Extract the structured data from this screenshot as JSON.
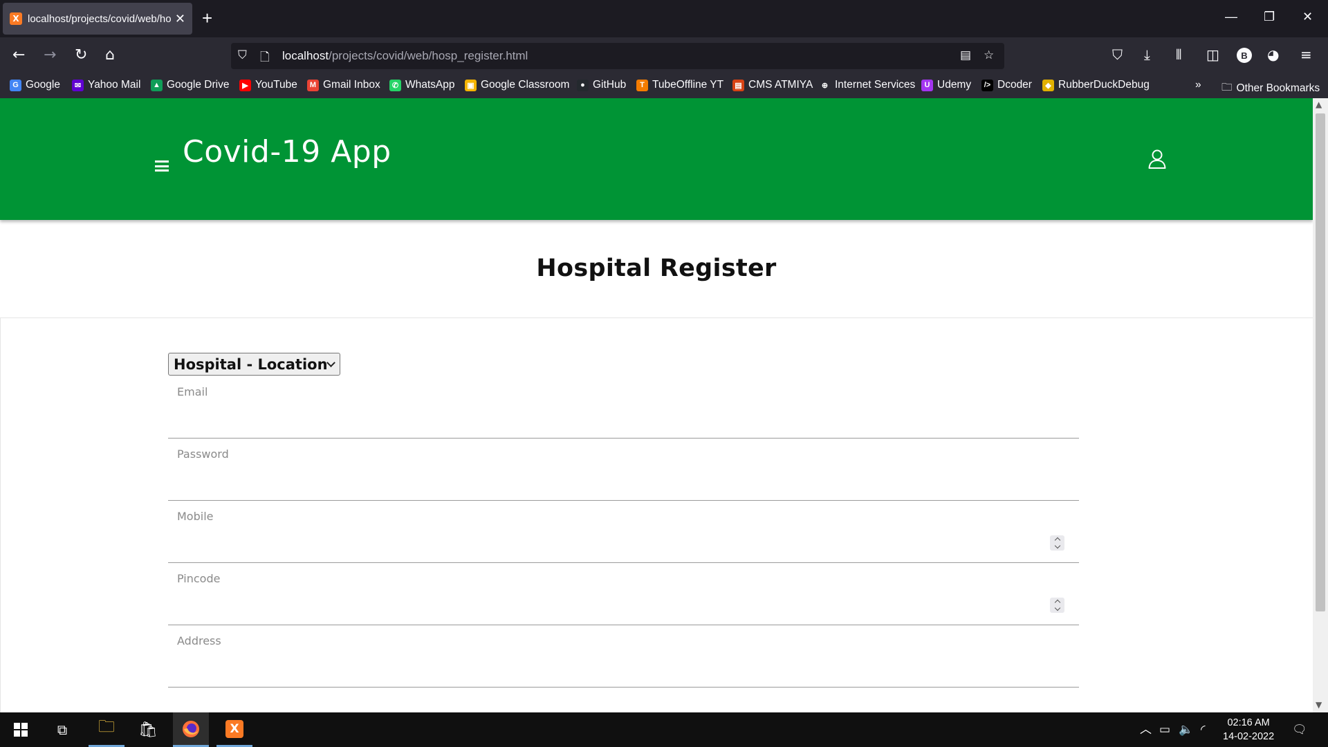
{
  "browser": {
    "tab_title": "localhost/projects/covid/web/hosp_register.html",
    "tab_favicon": "X",
    "new_tab_symbol": "+",
    "url_host": "localhost",
    "url_path": "/projects/covid/web/hosp_register.html",
    "bookmarks": [
      {
        "label": "Google",
        "icon": "google-icon",
        "color": "#4285f4",
        "glyph": "G"
      },
      {
        "label": "Yahoo Mail",
        "icon": "yahoo-mail-icon",
        "color": "#6001d2",
        "glyph": "✉"
      },
      {
        "label": "Google Drive",
        "icon": "google-drive-icon",
        "color": "#0f9d58",
        "glyph": "▲"
      },
      {
        "label": "YouTube",
        "icon": "youtube-icon",
        "color": "#ff0000",
        "glyph": "▶"
      },
      {
        "label": "Gmail Inbox",
        "icon": "gmail-icon",
        "color": "#ea4335",
        "glyph": "M"
      },
      {
        "label": "WhatsApp",
        "icon": "whatsapp-icon",
        "color": "#25d366",
        "glyph": "✆"
      },
      {
        "label": "Google Classroom",
        "icon": "google-classroom-icon",
        "color": "#f4b400",
        "glyph": "▣"
      },
      {
        "label": "GitHub",
        "icon": "github-icon",
        "color": "#24292e",
        "glyph": "●"
      },
      {
        "label": "TubeOffline YT",
        "icon": "tubeoffline-icon",
        "color": "#f57c00",
        "glyph": "T"
      },
      {
        "label": "CMS ATMIYA",
        "icon": "cms-atmiya-icon",
        "color": "#d84315",
        "glyph": "▤"
      },
      {
        "label": "Internet Services",
        "icon": "globe-icon",
        "color": "#2b2a33",
        "glyph": "⊕"
      },
      {
        "label": "Udemy",
        "icon": "udemy-icon",
        "color": "#a435f0",
        "glyph": "U"
      },
      {
        "label": "Dcoder",
        "icon": "dcoder-icon",
        "color": "#000000",
        "glyph": "/>"
      },
      {
        "label": "RubberDuckDebug",
        "icon": "duck-icon",
        "color": "#e0b000",
        "glyph": "◆"
      }
    ],
    "overflow_symbol": "»",
    "other_bookmarks": "Other Bookmarks",
    "account_initial": "B"
  },
  "app": {
    "title": "Covid-19 App",
    "brand_color": "#009435"
  },
  "page": {
    "heading": "Hospital Register",
    "select": {
      "selected": "Hospital - Location"
    },
    "fields": [
      {
        "label": "Email",
        "type": "email",
        "value": ""
      },
      {
        "label": "Password",
        "type": "password",
        "value": ""
      },
      {
        "label": "Mobile",
        "type": "number",
        "value": ""
      },
      {
        "label": "Pincode",
        "type": "number",
        "value": ""
      },
      {
        "label": "Address",
        "type": "text",
        "value": ""
      }
    ]
  },
  "taskbar": {
    "time": "02:16 AM",
    "date": "14-02-2022"
  }
}
